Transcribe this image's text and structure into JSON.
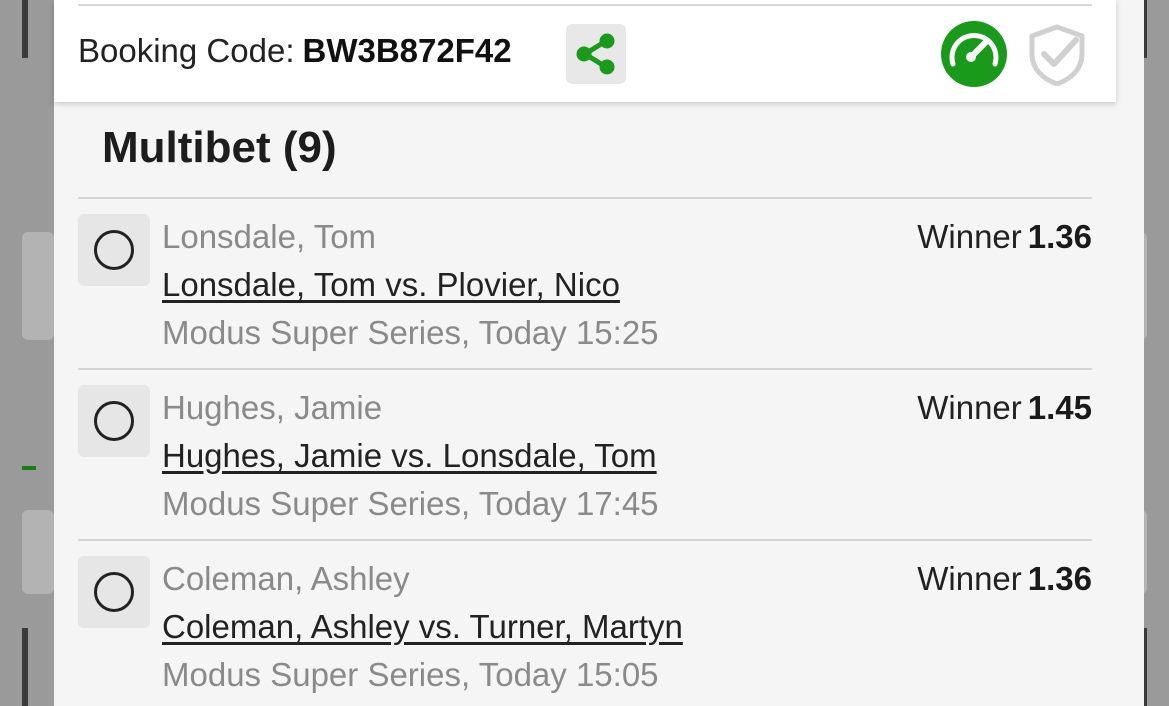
{
  "colors": {
    "accent_green": "#1a9a1a",
    "shield_grey": "#d0d0d0",
    "text_dark": "#222222",
    "text_muted": "#8a8a8a"
  },
  "header": {
    "booking_label": "Booking Code:",
    "booking_code": "BW3B872F42",
    "share_icon": "share-icon",
    "speed_icon": "speedometer-icon",
    "shield_icon": "shield-check-icon"
  },
  "section": {
    "title": "Multibet (9)"
  },
  "bets": [
    {
      "selection": "Lonsdale, Tom",
      "match": "Lonsdale, Tom vs. Plovier, Nico",
      "meta": "Modus Super Series, Today 15:25",
      "market": "Winner",
      "odds": "1.36"
    },
    {
      "selection": "Hughes, Jamie",
      "match": "Hughes, Jamie vs. Lonsdale, Tom",
      "meta": "Modus Super Series, Today 17:45",
      "market": "Winner",
      "odds": "1.45"
    },
    {
      "selection": "Coleman, Ashley",
      "match": "Coleman, Ashley vs. Turner, Martyn",
      "meta": "Modus Super Series, Today 15:05",
      "market": "Winner",
      "odds": "1.36"
    }
  ]
}
